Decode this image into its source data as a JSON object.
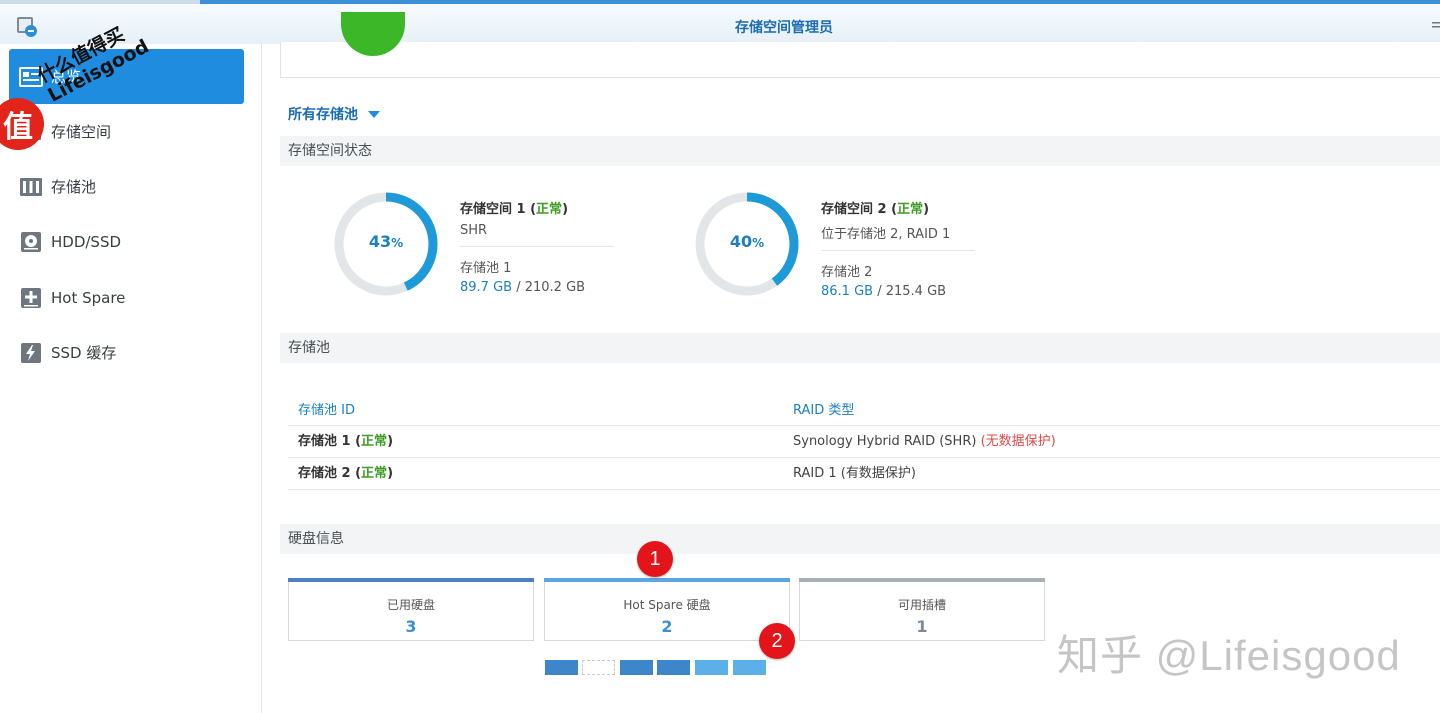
{
  "window": {
    "title": "存储空间管理员"
  },
  "sidebar": {
    "items": [
      {
        "label": "总览",
        "icon": "overview-icon",
        "active": true
      },
      {
        "label": "存储空间",
        "icon": "volume-icon",
        "active": false
      },
      {
        "label": "存储池",
        "icon": "storage-pool-icon",
        "active": false
      },
      {
        "label": "HDD/SSD",
        "icon": "disk-icon",
        "active": false
      },
      {
        "label": "Hot Spare",
        "icon": "hot-spare-icon",
        "active": false
      },
      {
        "label": "SSD 缓存",
        "icon": "ssd-cache-icon",
        "active": false
      }
    ]
  },
  "watermark": {
    "badge": "值",
    "line1": "什么值得买",
    "line2": "Lifeisgood",
    "zhihu": "知乎 @Lifeisgood"
  },
  "pool_selector": {
    "label": "所有存储池"
  },
  "volume_status": {
    "title": "存储空间状态",
    "volumes": [
      {
        "name": "存储空间 1",
        "status": "正常",
        "percent": 43,
        "pct_num": "43",
        "pct_sign": "%",
        "desc": "SHR",
        "pool": "存储池 1",
        "used": "89.7 GB",
        "total": "/ 210.2 GB"
      },
      {
        "name": "存储空间 2",
        "status": "正常",
        "percent": 40,
        "pct_num": "40",
        "pct_sign": "%",
        "desc": "位于存储池 2, RAID 1",
        "pool": "存储池 2",
        "used": "86.1 GB",
        "total": "/ 215.4 GB"
      }
    ]
  },
  "storage_pool": {
    "title": "存储池",
    "columns": [
      "存储池 ID",
      "RAID 类型"
    ],
    "rows": [
      {
        "name": "存储池 1",
        "status": "正常",
        "raid": "Synology Hybrid RAID (SHR)",
        "note": "(无数据保护)"
      },
      {
        "name": "存储池 2",
        "status": "正常",
        "raid": "RAID 1 (有数据保护)",
        "note": ""
      }
    ]
  },
  "disk_info": {
    "title": "硬盘信息",
    "cards": [
      {
        "label": "已用硬盘",
        "value": "3"
      },
      {
        "label": "Hot Spare 硬盘",
        "value": "2"
      },
      {
        "label": "可用插槽",
        "value": "1"
      }
    ],
    "markers": [
      "1",
      "2"
    ]
  },
  "colors": {
    "accent": "#1f8ce0",
    "ok": "#3c9e22",
    "warn": "#e04a4a",
    "donut_track": "#e3e6e9"
  }
}
